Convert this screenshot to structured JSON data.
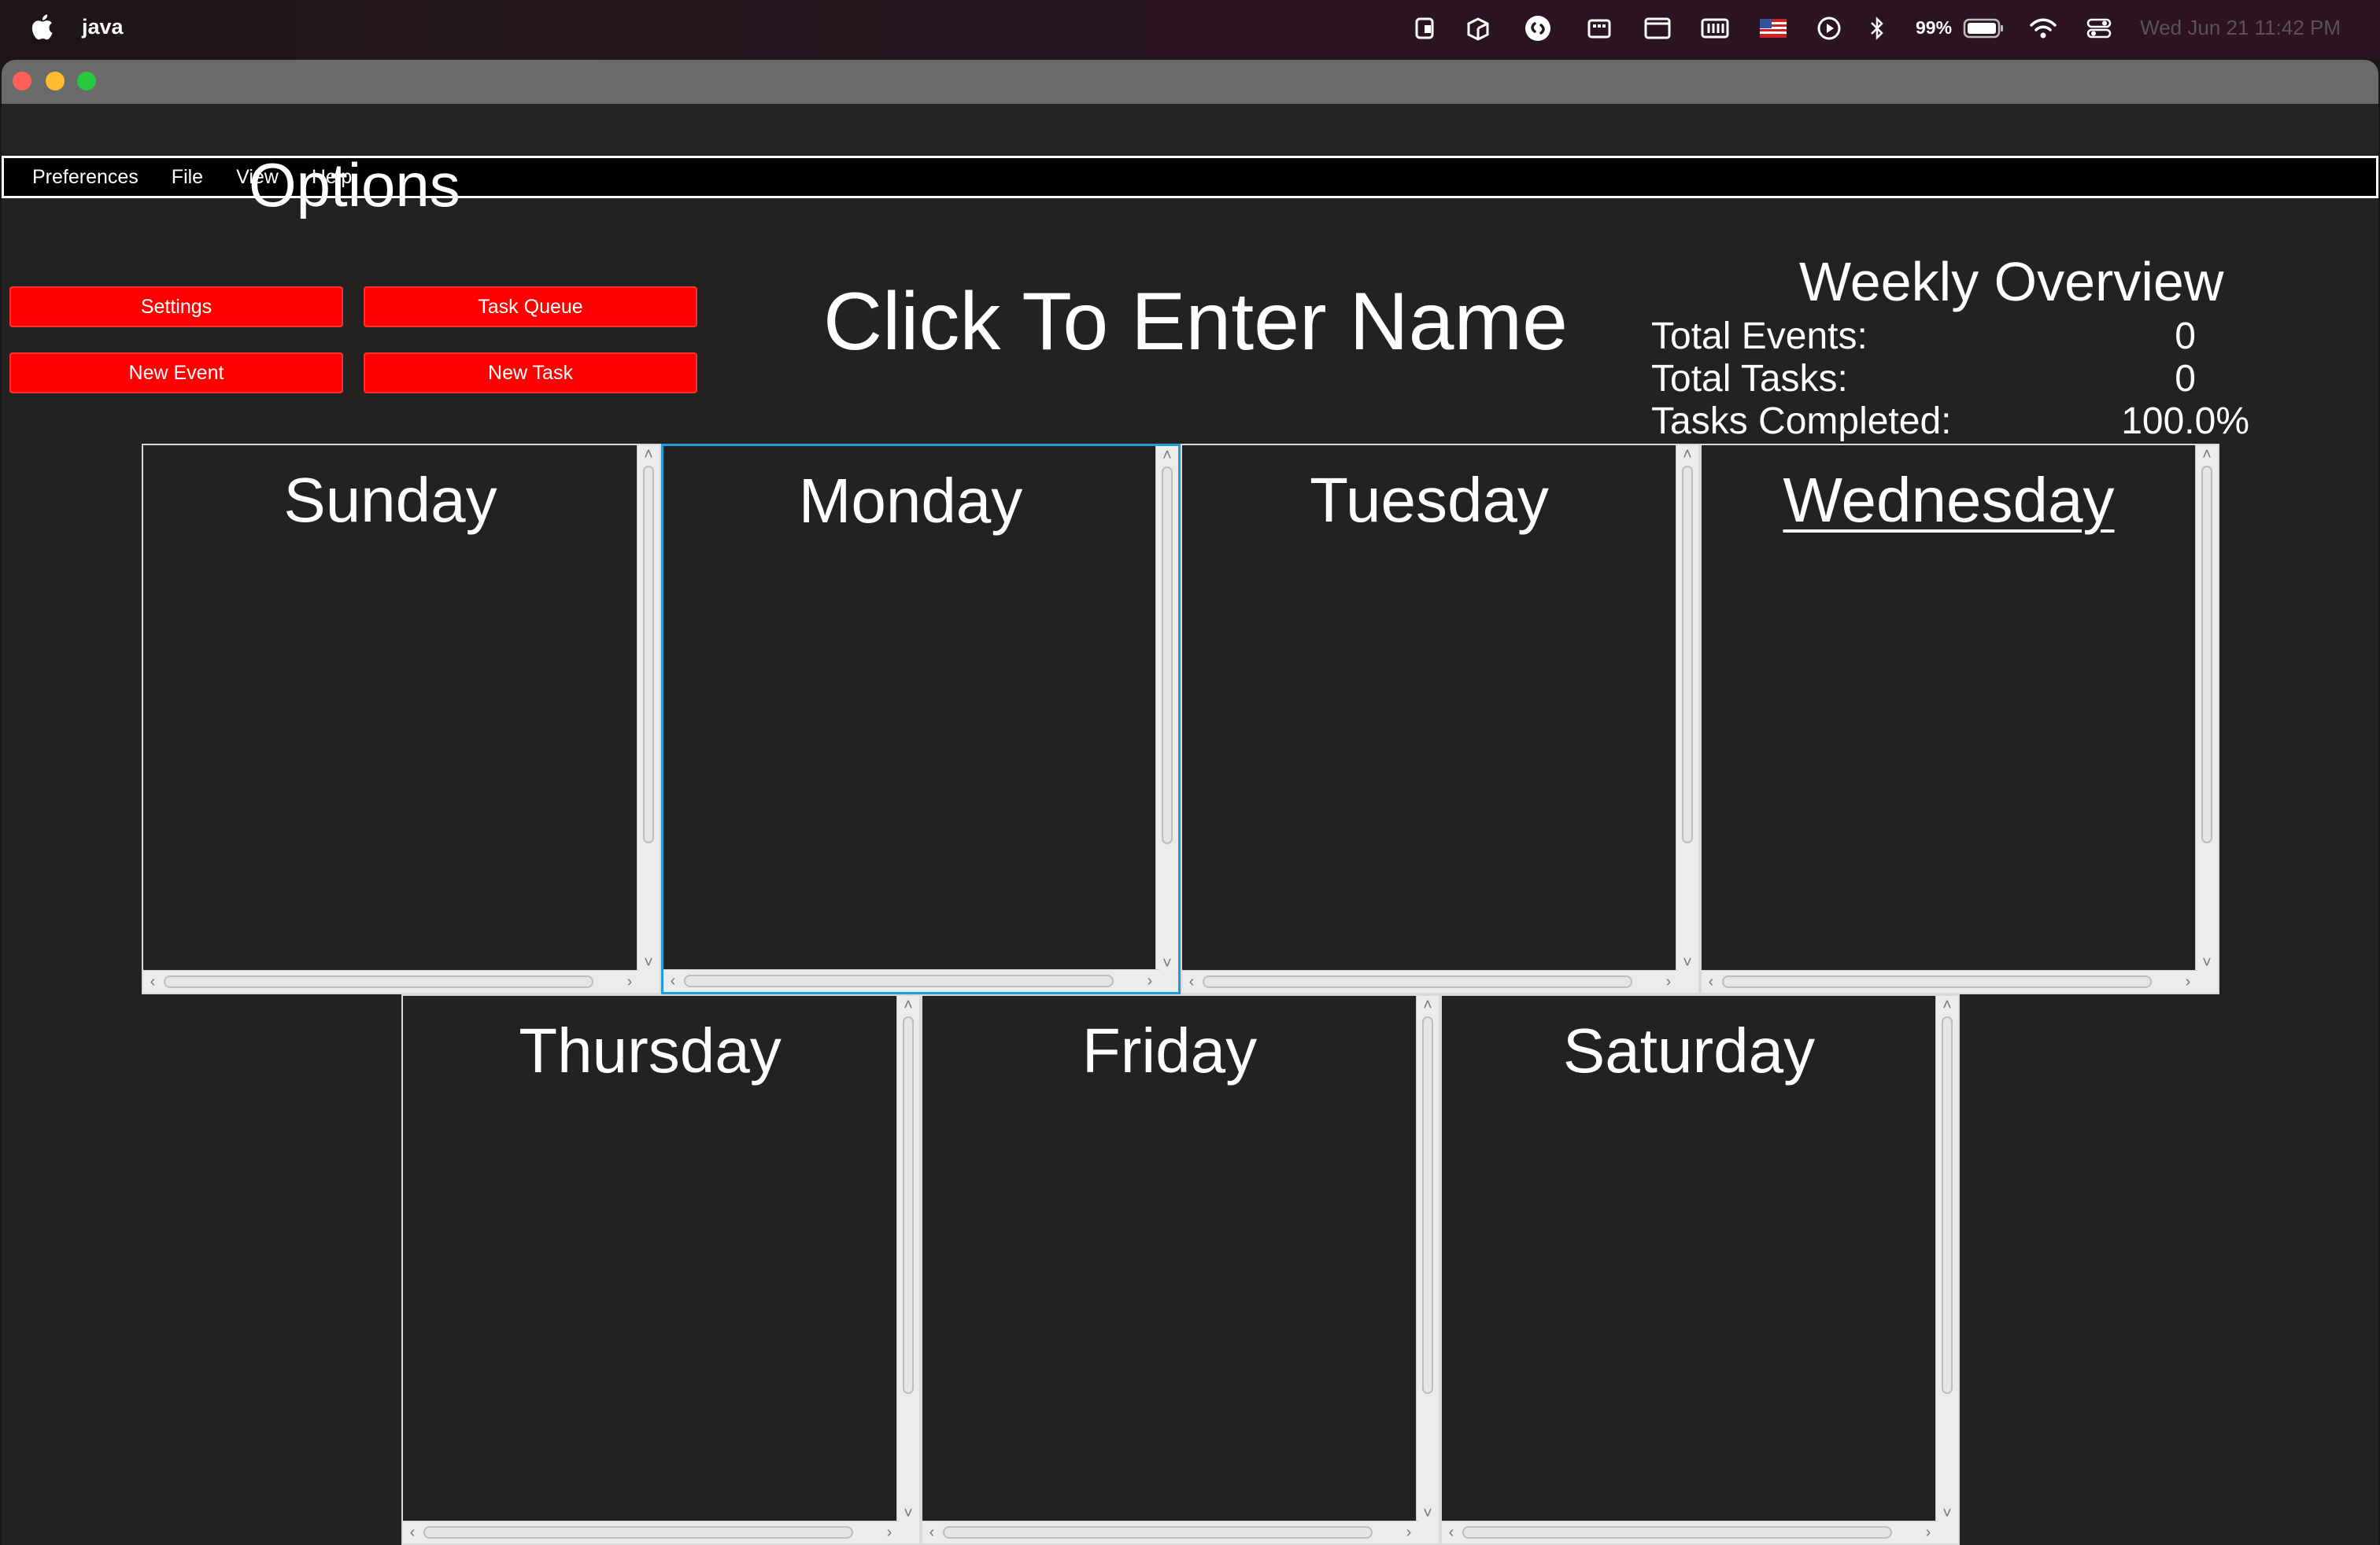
{
  "menubar": {
    "app_name": "java",
    "battery_percent": "99%",
    "clock": "Wed Jun 21  11:42 PM"
  },
  "app_menu": {
    "items": [
      "Preferences",
      "File",
      "View",
      "Help"
    ]
  },
  "options": {
    "title": "Options",
    "buttons": {
      "settings": "Settings",
      "task_queue": "Task Queue",
      "new_event": "New Event",
      "new_task": "New Task"
    },
    "button_color": "#ff0000"
  },
  "name_label": "Click To Enter Name",
  "weekly_overview": {
    "title": "Weekly Overview",
    "total_events_label": "Total Events:",
    "total_events_value": "0",
    "total_tasks_label": "Total Tasks:",
    "total_tasks_value": "0",
    "tasks_completed_label": "Tasks Completed:",
    "tasks_completed_value": "100.0%"
  },
  "days": {
    "sunday": "Sunday",
    "monday": "Monday",
    "tuesday": "Tuesday",
    "wednesday": "Wednesday",
    "thursday": "Thursday",
    "friday": "Friday",
    "saturday": "Saturday"
  },
  "today": "Wednesday",
  "focused_day": "Monday",
  "colors": {
    "focus_border": "#1f9cdb",
    "panel_bg": "#242121"
  }
}
